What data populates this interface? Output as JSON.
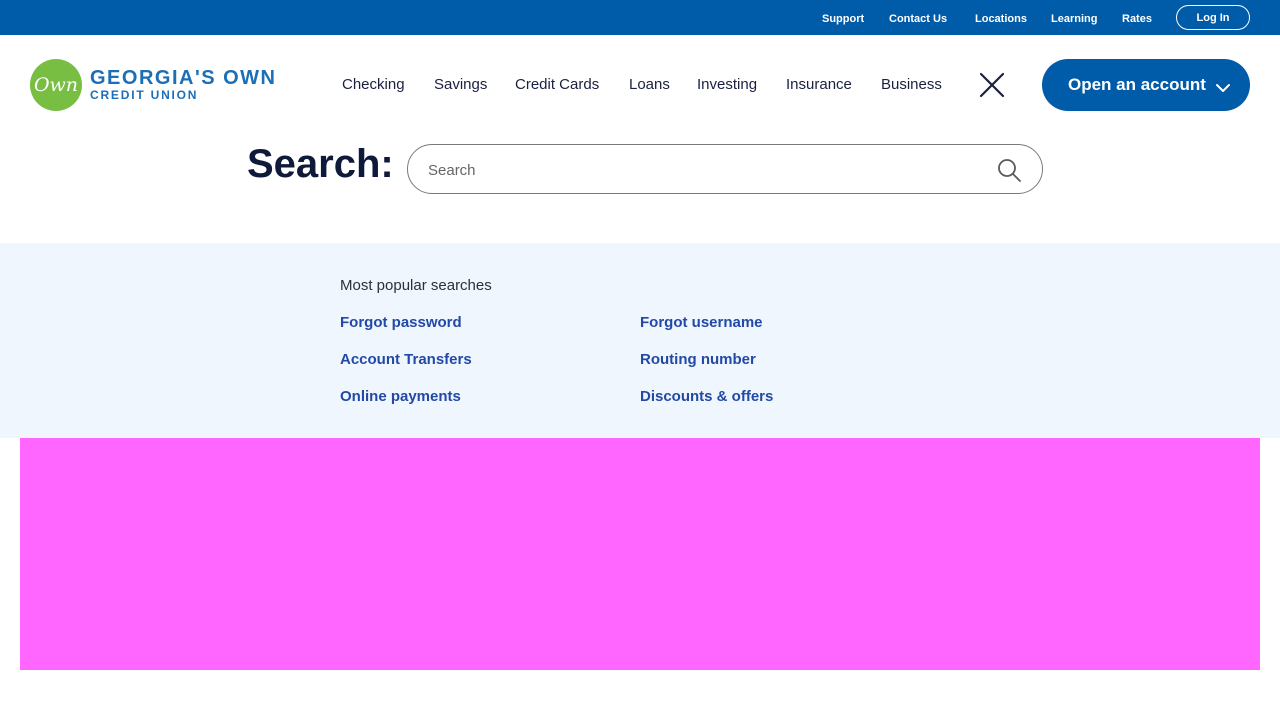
{
  "utility_nav": {
    "items": [
      "Support",
      "Contact Us",
      "Locations",
      "Learning",
      "Rates"
    ],
    "login_label": "Log In"
  },
  "logo": {
    "mark_text": "Own",
    "line1": "GEORGIA'S OWN",
    "line2": "CREDIT UNION"
  },
  "main_nav": {
    "items": [
      "Checking",
      "Savings",
      "Credit Cards",
      "Loans",
      "Investing",
      "Insurance",
      "Business"
    ],
    "open_account_label": "Open an account"
  },
  "search": {
    "title": "Search:",
    "placeholder": "Search",
    "value": ""
  },
  "popular": {
    "heading": "Most popular searches",
    "links": [
      "Forgot password",
      "Forgot username",
      "Account Transfers",
      "Routing number",
      "Online payments",
      "Discounts & offers"
    ]
  },
  "colors": {
    "brand_blue": "#005ba8",
    "logo_green": "#78be43",
    "link_blue": "#2349a6",
    "panel_bg": "#eff6fd",
    "placeholder_block": "#ff66ff"
  },
  "icons": [
    "close-icon",
    "chevron-down-icon",
    "search-icon"
  ]
}
